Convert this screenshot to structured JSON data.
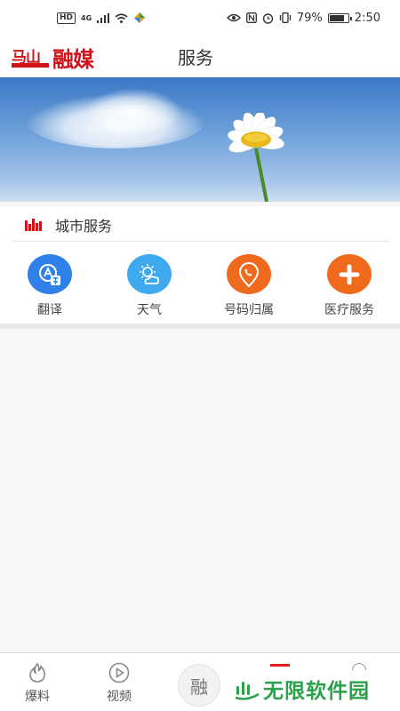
{
  "status_bar": {
    "network_badge": "HD",
    "signal_type": "4G",
    "battery_percent": "79%",
    "battery_level": 0.79,
    "time": "2:50"
  },
  "header": {
    "logo_left": "马山",
    "logo_right": "融媒",
    "title": "服务"
  },
  "city_services": {
    "section_title": "城市服务",
    "items": [
      {
        "label": "翻译",
        "icon": "translate-icon",
        "color": "#2f80e8"
      },
      {
        "label": "天气",
        "icon": "weather-icon",
        "color": "#3fa9f0"
      },
      {
        "label": "号码归属",
        "icon": "phone-location-icon",
        "color": "#f06a1d"
      },
      {
        "label": "医疗服务",
        "icon": "medical-plus-icon",
        "color": "#f06a1d"
      }
    ]
  },
  "bottom_nav": {
    "items": [
      {
        "label": "爆料",
        "icon": "fire-icon"
      },
      {
        "label": "视频",
        "icon": "play-icon"
      }
    ],
    "center_label": "融"
  },
  "watermark": {
    "text": "无限软件园"
  },
  "colors": {
    "brand_red": "#d0121b",
    "watermark_green": "#2ba24a"
  }
}
